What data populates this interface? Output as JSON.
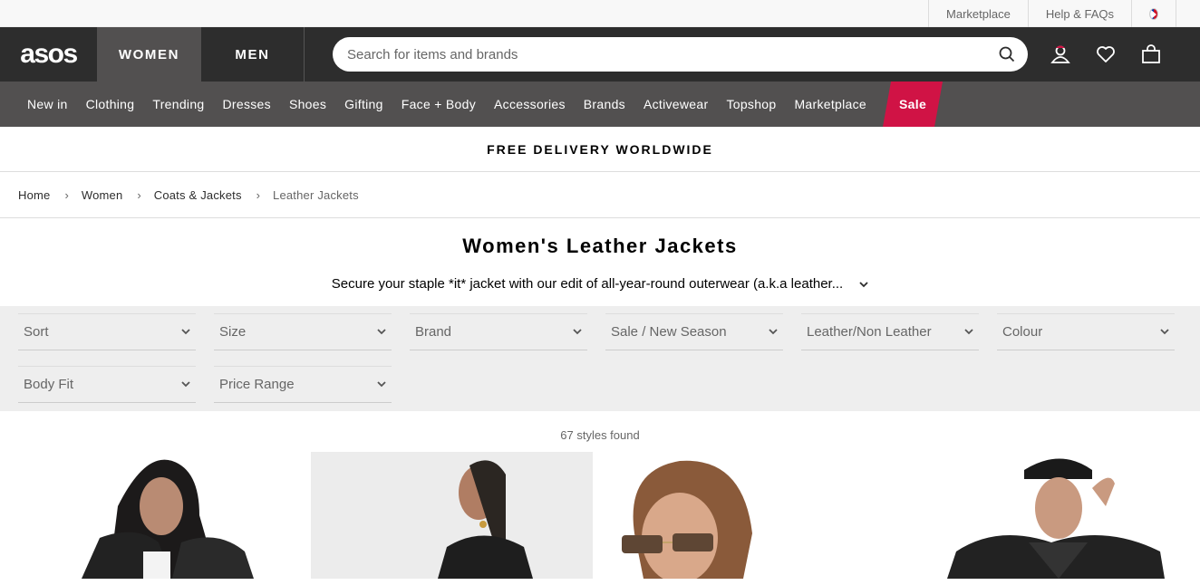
{
  "util": {
    "marketplace": "Marketplace",
    "help": "Help & FAQs"
  },
  "header": {
    "logo": "asos",
    "women": "WOMEN",
    "men": "MEN",
    "search_placeholder": "Search for items and brands",
    "icons": [
      "account-icon",
      "heart-icon",
      "bag-icon"
    ]
  },
  "nav": [
    "New in",
    "Clothing",
    "Trending",
    "Dresses",
    "Shoes",
    "Gifting",
    "Face + Body",
    "Accessories",
    "Brands",
    "Activewear",
    "Topshop",
    "Marketplace",
    "Sale"
  ],
  "promo": "FREE DELIVERY WORLDWIDE",
  "breadcrumb": [
    "Home",
    "Women",
    "Coats & Jackets",
    "Leather Jackets"
  ],
  "page": {
    "title": "Women's Leather Jackets",
    "description": "Secure your staple *it* jacket with our edit of all-year-round outerwear (a.k.a leather..."
  },
  "filters": [
    "Sort",
    "Size",
    "Brand",
    "Sale / New Season",
    "Leather/Non Leather",
    "Colour",
    "Body Fit",
    "Price Range"
  ],
  "results": {
    "count": "67 styles found"
  },
  "colors": {
    "header_bg": "#2d2d2d",
    "nav_bg": "#525050",
    "sale": "#d01345",
    "filter_bg": "#eeeeee"
  }
}
